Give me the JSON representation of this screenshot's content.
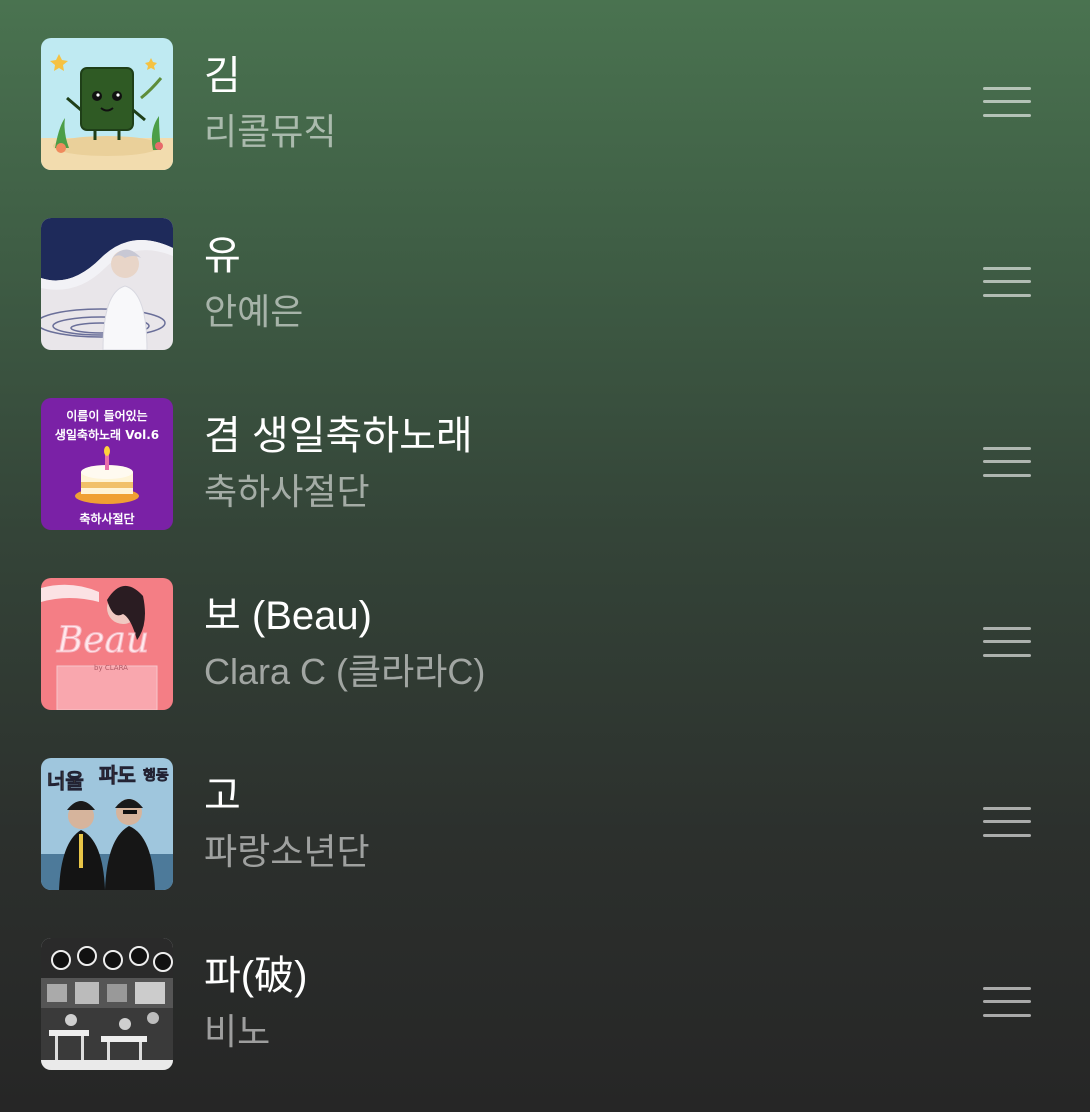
{
  "tracks": [
    {
      "title": "김",
      "artist": "리콜뮤직"
    },
    {
      "title": "유",
      "artist": "안예은"
    },
    {
      "title": "겸 생일축하노래",
      "artist": "축하사절단",
      "cover_text": [
        "이름이 들어있는",
        "생일축하노래 Vol.6",
        "축하사절단"
      ]
    },
    {
      "title": "보 (Beau)",
      "artist": "Clara C (클라라C)",
      "cover_text": [
        "Beau",
        "by CLARA"
      ]
    },
    {
      "title": "고",
      "artist": "파랑소년단",
      "cover_text": [
        "너울",
        "파도",
        "행동"
      ]
    },
    {
      "title": "파(破)",
      "artist": "비노"
    }
  ],
  "icons": {
    "reorder": "reorder-handle-icon"
  },
  "colors": {
    "background_top": "#4a7350",
    "background_bottom": "#262626",
    "title": "#ffffff",
    "subtitle": "#8f948f",
    "handle": "#9a9a9a"
  }
}
